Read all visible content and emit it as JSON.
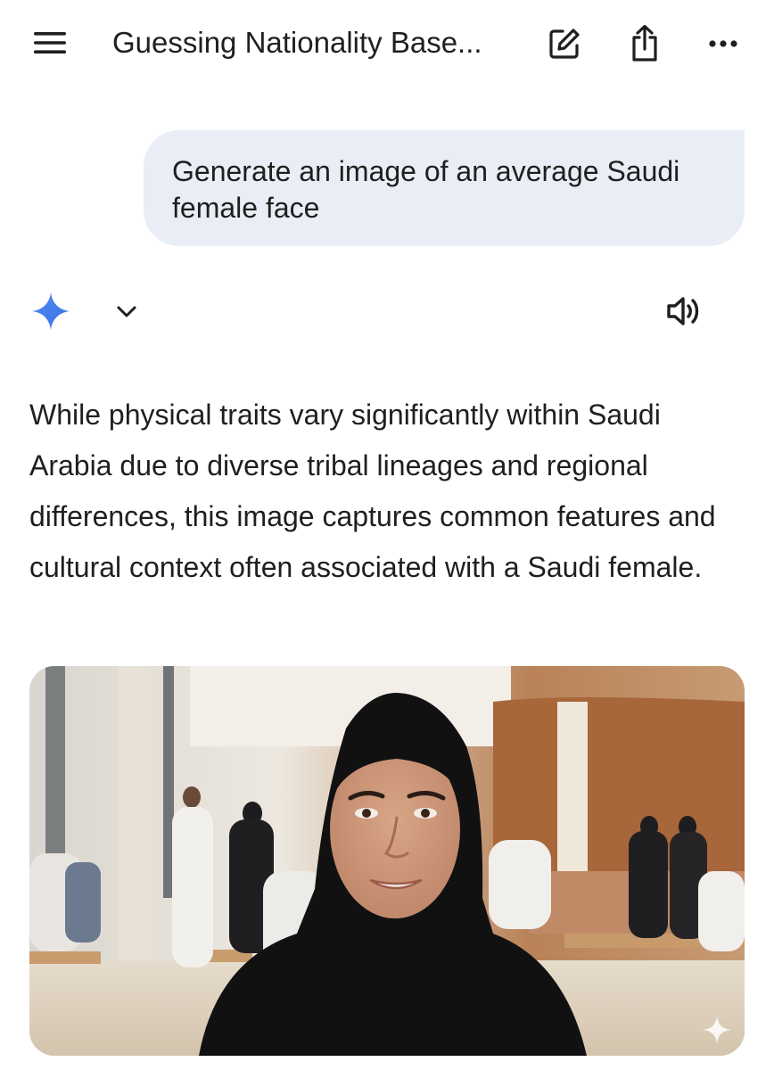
{
  "header": {
    "title": "Guessing Nationality Base...",
    "icons": [
      "menu-icon",
      "edit-icon",
      "share-icon",
      "more-icon"
    ]
  },
  "conversation": {
    "user_message": "Generate an image of an average Saudi female face",
    "response": {
      "icons": [
        "gemini-sparkle-icon",
        "chevron-down-icon",
        "speaker-icon"
      ],
      "text": "While physical traits vary significantly within Saudi Arabia due to diverse tribal lineages and regional differences, this image captures common features and cultural context often associated with a Saudi female.",
      "image": {
        "subject": "generated-portrait",
        "watermark_icon": "sparkle-watermark-icon"
      }
    }
  },
  "colors": {
    "bubble_bg": "#e9eef6",
    "text": "#1f1f1f",
    "accent_blue": "#4285f4"
  }
}
